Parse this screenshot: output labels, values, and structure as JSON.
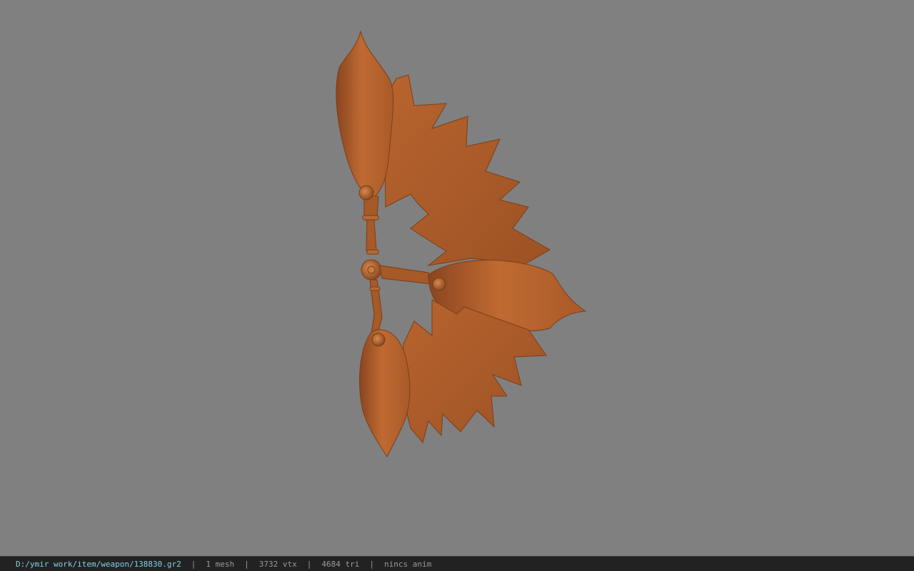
{
  "viewer": {
    "background_color": "#808080",
    "model_color": "#b8642e",
    "model": {
      "name": "weapon-mesh",
      "description_icon": "bladed-fan-weapon"
    }
  },
  "status_bar": {
    "file_path": "D:/ymir work/item/weapon/138830.gr2",
    "separator": "|",
    "mesh_count": "1 mesh",
    "vertex_count": "3732 vtx",
    "triangle_count": "4684 tri",
    "animation": "nincs anim"
  }
}
